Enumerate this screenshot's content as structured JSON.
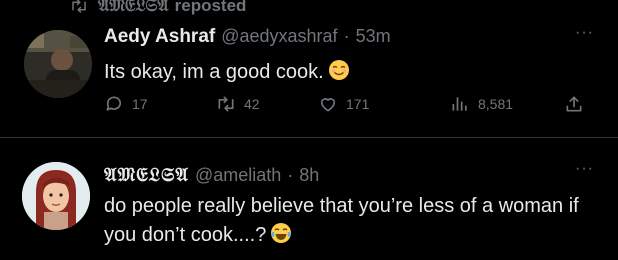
{
  "repost_banner": {
    "actor": "𝔄𝔐𝔈𝔏𝔖𝔄",
    "label": "reposted"
  },
  "tweets": [
    {
      "name": "Aedy Ashraf",
      "handle": "@aedyxashraf",
      "separator": "·",
      "time": "53m",
      "text": "Its okay, im a good cook.",
      "emoji": "relieved-face",
      "more": "···",
      "stats": {
        "replies": "17",
        "reposts": "42",
        "likes": "171",
        "views": "8,581"
      }
    },
    {
      "name": "𝔄𝔐𝔈𝔏𝔖𝔄",
      "handle": "@ameliath",
      "separator": "·",
      "time": "8h",
      "text": "do people really believe that you’re less of a woman if you don’t cook....?",
      "emoji": "tears-of-joy-face",
      "more": "···"
    }
  ],
  "colors": {
    "background": "#000000",
    "text": "#e7e9ea",
    "muted": "#71767b",
    "divider": "#2f3336"
  },
  "icons": [
    "repost-icon",
    "reply-icon",
    "like-icon",
    "views-icon",
    "share-icon",
    "more-icon"
  ]
}
